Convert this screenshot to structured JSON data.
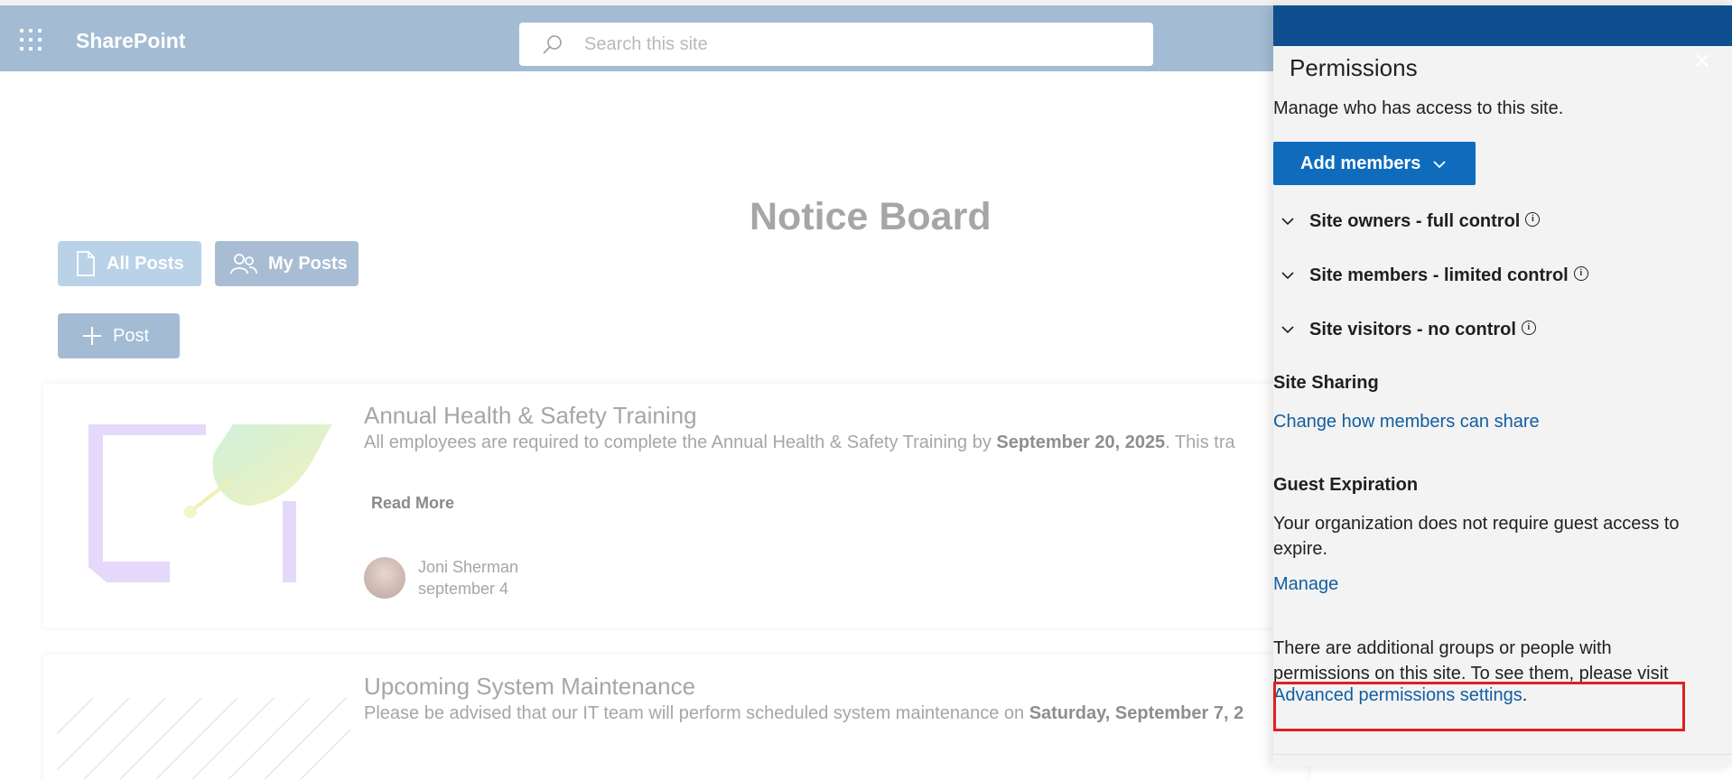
{
  "suitebar": {
    "app_name": "SharePoint",
    "search_placeholder": "Search this site"
  },
  "page": {
    "title": "Notice Board",
    "buttons": {
      "all_posts": "All Posts",
      "my_posts": "My Posts",
      "post": "Post"
    },
    "posts": [
      {
        "title": "Annual Health & Safety Training",
        "text_prefix": "All employees are required to complete the Annual Health & Safety Training by ",
        "text_bold": "September 20, 2025",
        "text_suffix": ". This tra",
        "read_more": "Read More",
        "author": "Joni Sherman",
        "date": "september 4"
      },
      {
        "title": "Upcoming System Maintenance",
        "text_prefix": "Please be advised that our IT team will perform scheduled system maintenance on ",
        "text_bold": "Saturday, September 7, 2",
        "text_suffix": ""
      }
    ]
  },
  "panel": {
    "title": "Permissions",
    "close_icon": "close-icon",
    "subtitle": "Manage who has access to this site.",
    "add_members": "Add members",
    "groups": [
      {
        "label": "Site owners - full control"
      },
      {
        "label": "Site members - limited control"
      },
      {
        "label": "Site visitors - no control"
      }
    ],
    "site_sharing": {
      "heading": "Site Sharing",
      "link": "Change how members can share"
    },
    "guest_expiration": {
      "heading": "Guest Expiration",
      "text": "Your organization does not require guest access to expire.",
      "link": "Manage"
    },
    "advanced": {
      "text": "There are additional groups or people with permissions on this site. To see them, please visit",
      "link": "Advanced permissions settings",
      "suffix": "."
    }
  },
  "colors": {
    "suitebar_dimmed": "#a3bcd4",
    "panel_header": "#0f4f8f",
    "primary_button": "#0f6cbd",
    "link": "#115ea3",
    "highlight": "#e02020"
  }
}
